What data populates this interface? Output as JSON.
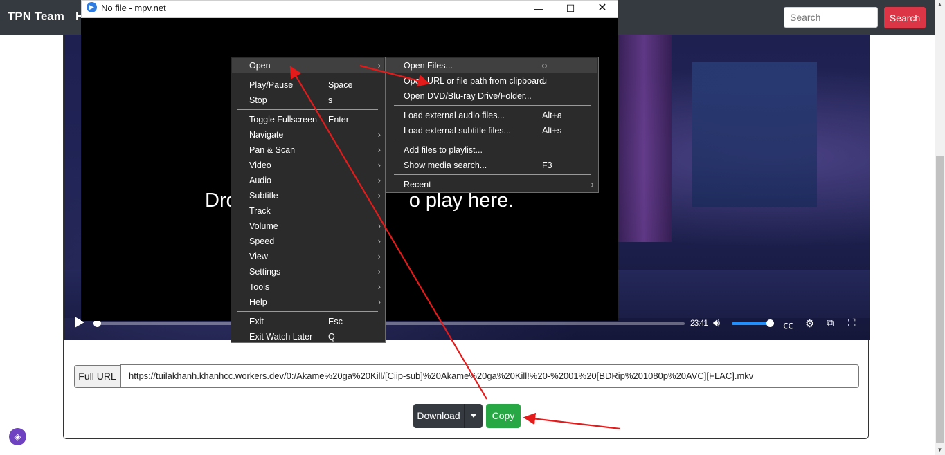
{
  "site": {
    "brand": "TPN Team",
    "nav_partial": "H",
    "search_placeholder": "Search",
    "search_button": "Search"
  },
  "mpv": {
    "title": "No file - mpv.net",
    "drop_text": "Drop files to play here.",
    "drop_visible_left": "Dro",
    "drop_visible_right": "o play here."
  },
  "player": {
    "time": "23:41",
    "volume_fraction": 0.85,
    "progress_fraction": 0.0
  },
  "url_row": {
    "label": "Full URL",
    "value": "https://tuilakhanh.khanhcc.workers.dev/0:/Akame%20ga%20Kill/[Ciip-sub]%20Akame%20ga%20Kill!%20-%2001%20[BDRip%201080p%20AVC][FLAC].mkv"
  },
  "buttons": {
    "download": "Download",
    "copy": "Copy"
  },
  "main_menu": [
    {
      "label": "Open",
      "submenu": true,
      "highlighted": true
    },
    {
      "separator": true
    },
    {
      "label": "Play/Pause",
      "shortcut": "Space"
    },
    {
      "label": "Stop",
      "shortcut": "s"
    },
    {
      "separator": true
    },
    {
      "label": "Toggle Fullscreen",
      "shortcut": "Enter"
    },
    {
      "label": "Navigate",
      "submenu": true
    },
    {
      "label": "Pan & Scan",
      "submenu": true
    },
    {
      "label": "Video",
      "submenu": true
    },
    {
      "label": "Audio",
      "submenu": true
    },
    {
      "label": "Subtitle",
      "submenu": true
    },
    {
      "label": "Track",
      "submenu": false
    },
    {
      "label": "Volume",
      "submenu": true
    },
    {
      "label": "Speed",
      "submenu": true
    },
    {
      "label": "View",
      "submenu": true
    },
    {
      "label": "Settings",
      "submenu": true
    },
    {
      "label": "Tools",
      "submenu": true
    },
    {
      "label": "Help",
      "submenu": true
    },
    {
      "separator": true
    },
    {
      "label": "Exit",
      "shortcut": "Esc"
    },
    {
      "label": "Exit Watch Later",
      "shortcut": "Q"
    }
  ],
  "open_submenu": [
    {
      "label": "Open Files...",
      "shortcut": "o",
      "highlighted": true
    },
    {
      "label": "Open URL or file path from clipboard",
      "shortcut": "u"
    },
    {
      "label": "Open DVD/Blu-ray Drive/Folder..."
    },
    {
      "separator": true
    },
    {
      "label": "Load external audio files...",
      "shortcut": "Alt+a"
    },
    {
      "label": "Load external subtitle files...",
      "shortcut": "Alt+s"
    },
    {
      "separator": true
    },
    {
      "label": "Add files to playlist..."
    },
    {
      "label": "Show media search...",
      "shortcut": "F3"
    },
    {
      "separator": true
    },
    {
      "label": "Recent",
      "submenu": true
    }
  ],
  "colors": {
    "navbar": "#343a40",
    "search_button": "#dc3545",
    "copy_button": "#28a745",
    "annotation_arrow": "#e31b1b",
    "menu_bg": "#2b2b2b"
  }
}
